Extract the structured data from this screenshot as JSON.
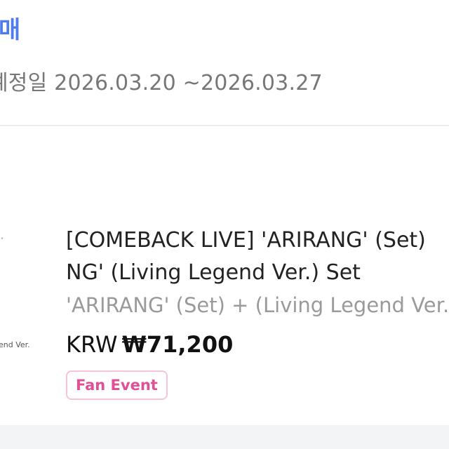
{
  "status": {
    "title": "매"
  },
  "schedule": {
    "label": "예정일",
    "range": "2026.03.20 ~2026.03.27"
  },
  "product": {
    "thumbnail": {
      "caption": "end Ver."
    },
    "title_line1": "[COMEBACK LIVE] 'ARIRANG' (Set)",
    "title_line2": "NG' (Living Legend Ver.) Set",
    "subtitle": "'ARIRANG' (Set) + (Living Legend Ver.)",
    "price_currency": "KRW",
    "price_value": "₩71,200",
    "badge": "Fan Event"
  },
  "colors": {
    "accent": "#4e7cf0",
    "badge_text": "#e14f95",
    "badge_border": "#f6c3db",
    "muted_text": "#777777",
    "bottom_strip": "#f2f4f6"
  }
}
